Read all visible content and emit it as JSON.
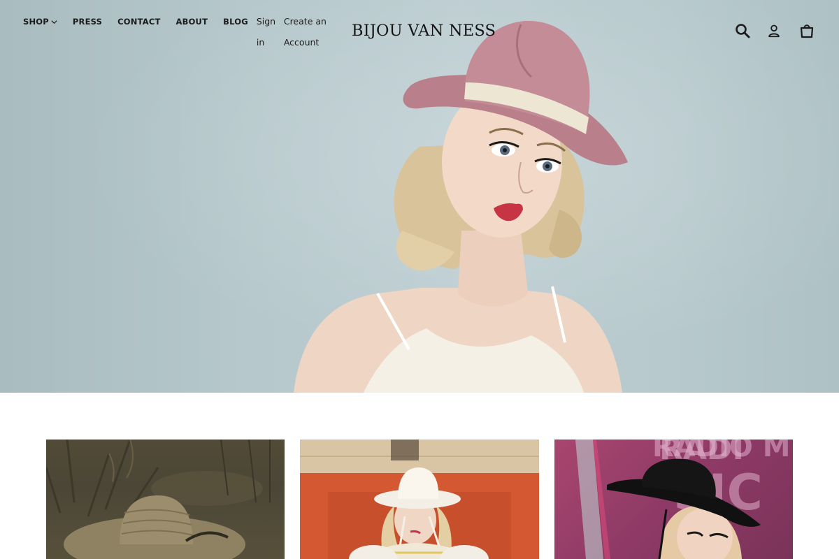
{
  "brand": {
    "logo_text": "BIJOU VAN NESS"
  },
  "nav": {
    "items": [
      {
        "label": "SHOP",
        "has_dropdown": true
      },
      {
        "label": "PRESS"
      },
      {
        "label": "CONTACT"
      },
      {
        "label": "ABOUT"
      },
      {
        "label": "BLOG"
      }
    ],
    "account_links": {
      "sign_in": "Sign in",
      "create_account": "Create an Account"
    }
  },
  "header_icons": {
    "search": "search-icon",
    "account": "user-icon",
    "cart": "cart-icon"
  },
  "tiles": {
    "tile_3_backdrop_text": "RADIO MUSIC AWARDS"
  },
  "colors": {
    "hero_bg": "#b8cacd",
    "hat_pink": "#c08a92",
    "hat_band": "#ece6d2",
    "tile_2_bg": "#cf5a35",
    "tile_3_bg": "#8e3a66"
  }
}
